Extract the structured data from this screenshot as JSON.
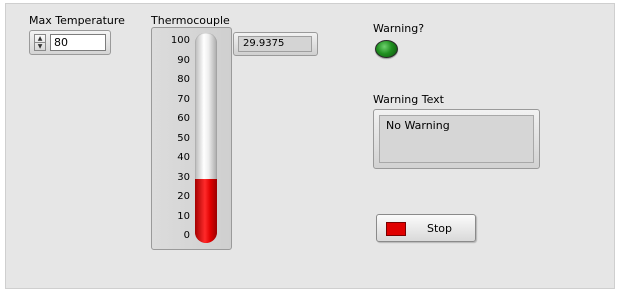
{
  "max_temperature": {
    "label": "Max Temperature",
    "value": "80"
  },
  "thermocouple": {
    "label": "Thermocouple",
    "reading": "29.9375",
    "scale_min": 0,
    "scale_max": 100,
    "fill_value": 29.9375,
    "ticks": [
      "100",
      "90",
      "80",
      "70",
      "60",
      "50",
      "40",
      "30",
      "20",
      "10",
      "0"
    ],
    "mercury_color": "#e00000"
  },
  "warning": {
    "label": "Warning?",
    "state": "off",
    "led_color": "#1f8f1f"
  },
  "warning_text": {
    "label": "Warning Text",
    "value": "No Warning"
  },
  "stop": {
    "label": "Stop",
    "indicator_color": "#e00000"
  },
  "icons": {
    "increment": "increment-arrow-icon",
    "decrement": "decrement-arrow-icon"
  },
  "colors": {
    "panel_background": "#e6e6e6",
    "indicator_background": "#d4d4d4"
  }
}
